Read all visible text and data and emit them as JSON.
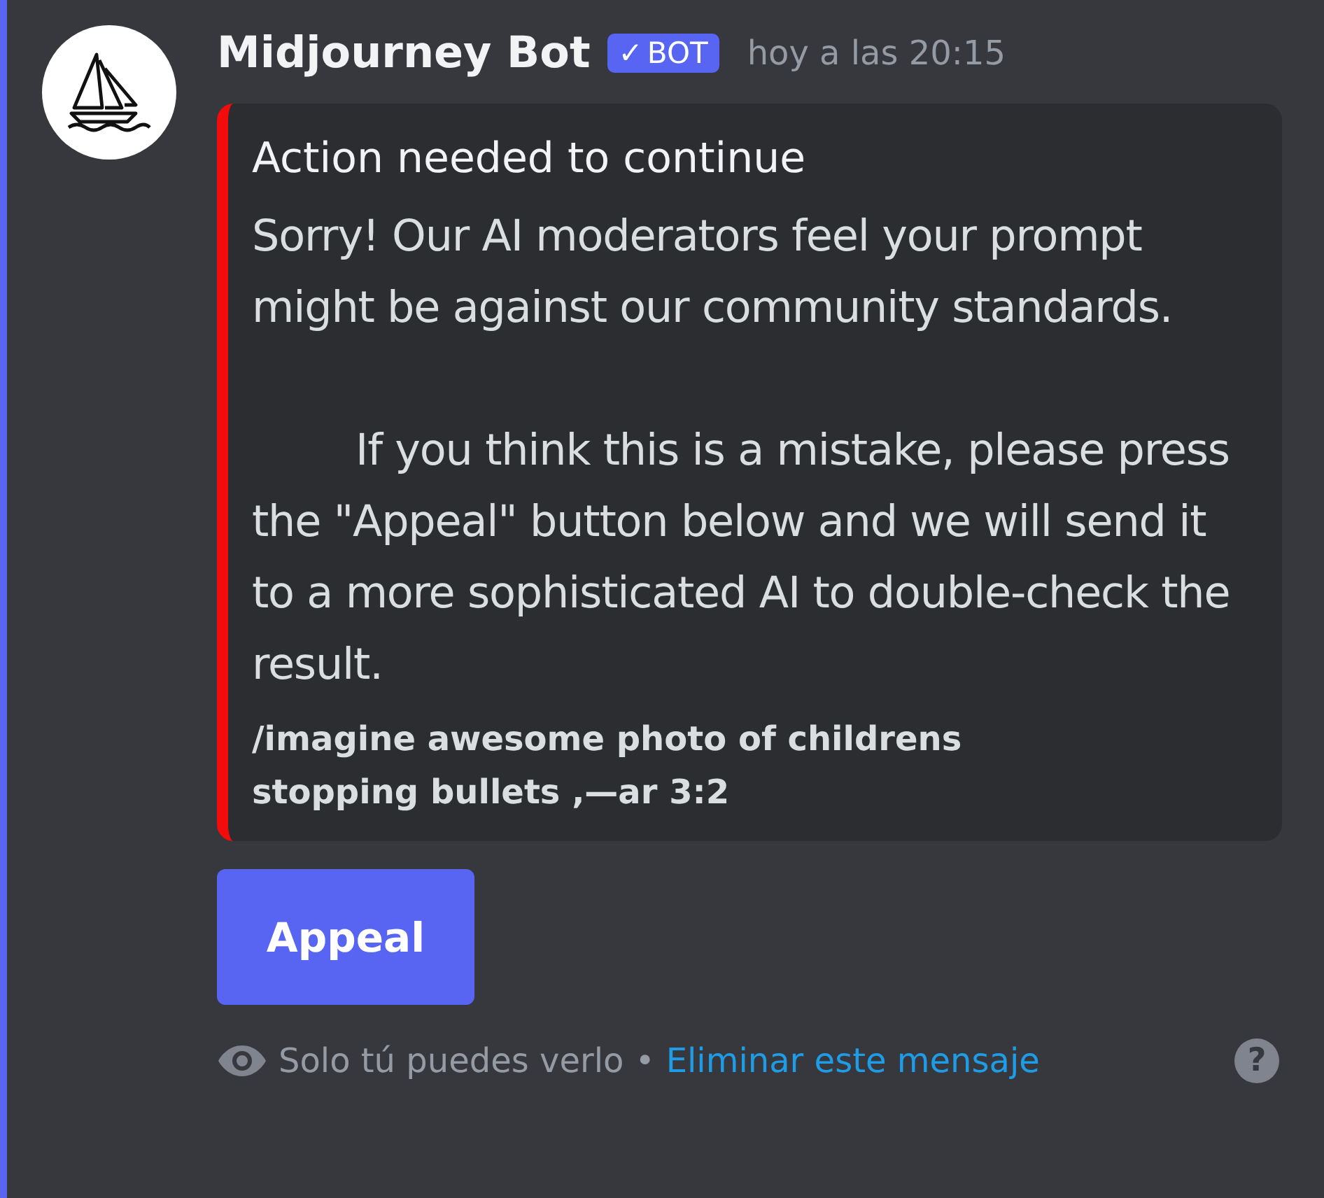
{
  "message": {
    "author": "Midjourney Bot",
    "badge": {
      "check": "✓",
      "label": "BOT"
    },
    "timestamp": "hoy a las 20:15"
  },
  "embed": {
    "color": "#f20c0c",
    "title": "Action needed to continue",
    "description": "Sorry! Our AI moderators feel your prompt might be against our community standards.\n\n        If you think this is a mistake, please press the \"Appeal\" button below and we will send it to a more sophisticated AI to double-check the result.",
    "footer": "/imagine awesome photo of childrens  stopping bullets ,—ar 3:2"
  },
  "buttons": [
    {
      "label": "Appeal"
    }
  ],
  "ephemeral": {
    "notice": "Solo tú puedes verlo",
    "separator": "•",
    "link": "Eliminar este mensaje",
    "help": "?"
  }
}
